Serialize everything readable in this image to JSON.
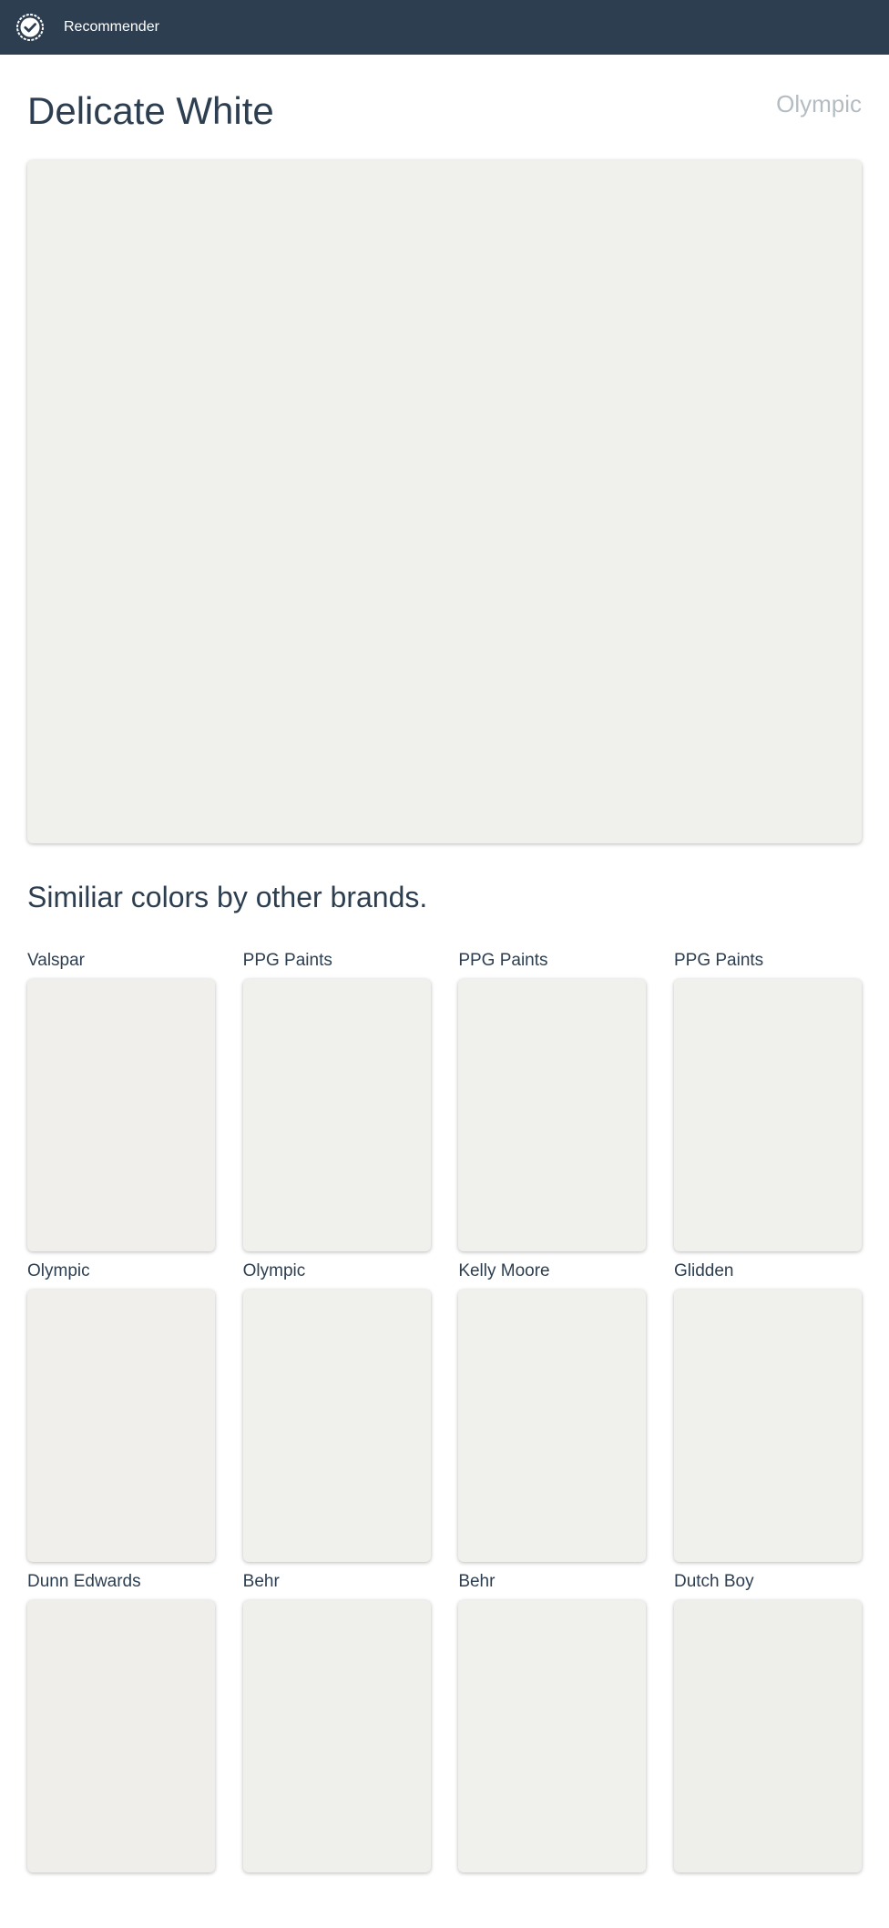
{
  "header": {
    "brand": "Recommender",
    "logo_icon": "check-badge-icon",
    "background_color": "#2c3e50"
  },
  "color": {
    "name": "Delicate White",
    "brand": "Olympic",
    "swatch_color": "#f0f0ec"
  },
  "similar": {
    "heading": "Similiar colors by other brands.",
    "items": [
      {
        "brand": "Valspar",
        "swatch_color": "#f0efeb"
      },
      {
        "brand": "PPG Paints",
        "swatch_color": "#f0f0ec"
      },
      {
        "brand": "PPG Paints",
        "swatch_color": "#f0f0ec"
      },
      {
        "brand": "PPG Paints",
        "swatch_color": "#f0f0ec"
      },
      {
        "brand": "Olympic",
        "swatch_color": "#f0efeb"
      },
      {
        "brand": "Olympic",
        "swatch_color": "#f0f0ec"
      },
      {
        "brand": "Kelly Moore",
        "swatch_color": "#f0f0ec"
      },
      {
        "brand": "Glidden",
        "swatch_color": "#f0f0ec"
      },
      {
        "brand": "Dunn Edwards",
        "swatch_color": "#efeeea"
      },
      {
        "brand": "Behr",
        "swatch_color": "#eff0ec"
      },
      {
        "brand": "Behr",
        "swatch_color": "#f0f0ec"
      },
      {
        "brand": "Dutch Boy",
        "swatch_color": "#eeeeea"
      }
    ]
  }
}
